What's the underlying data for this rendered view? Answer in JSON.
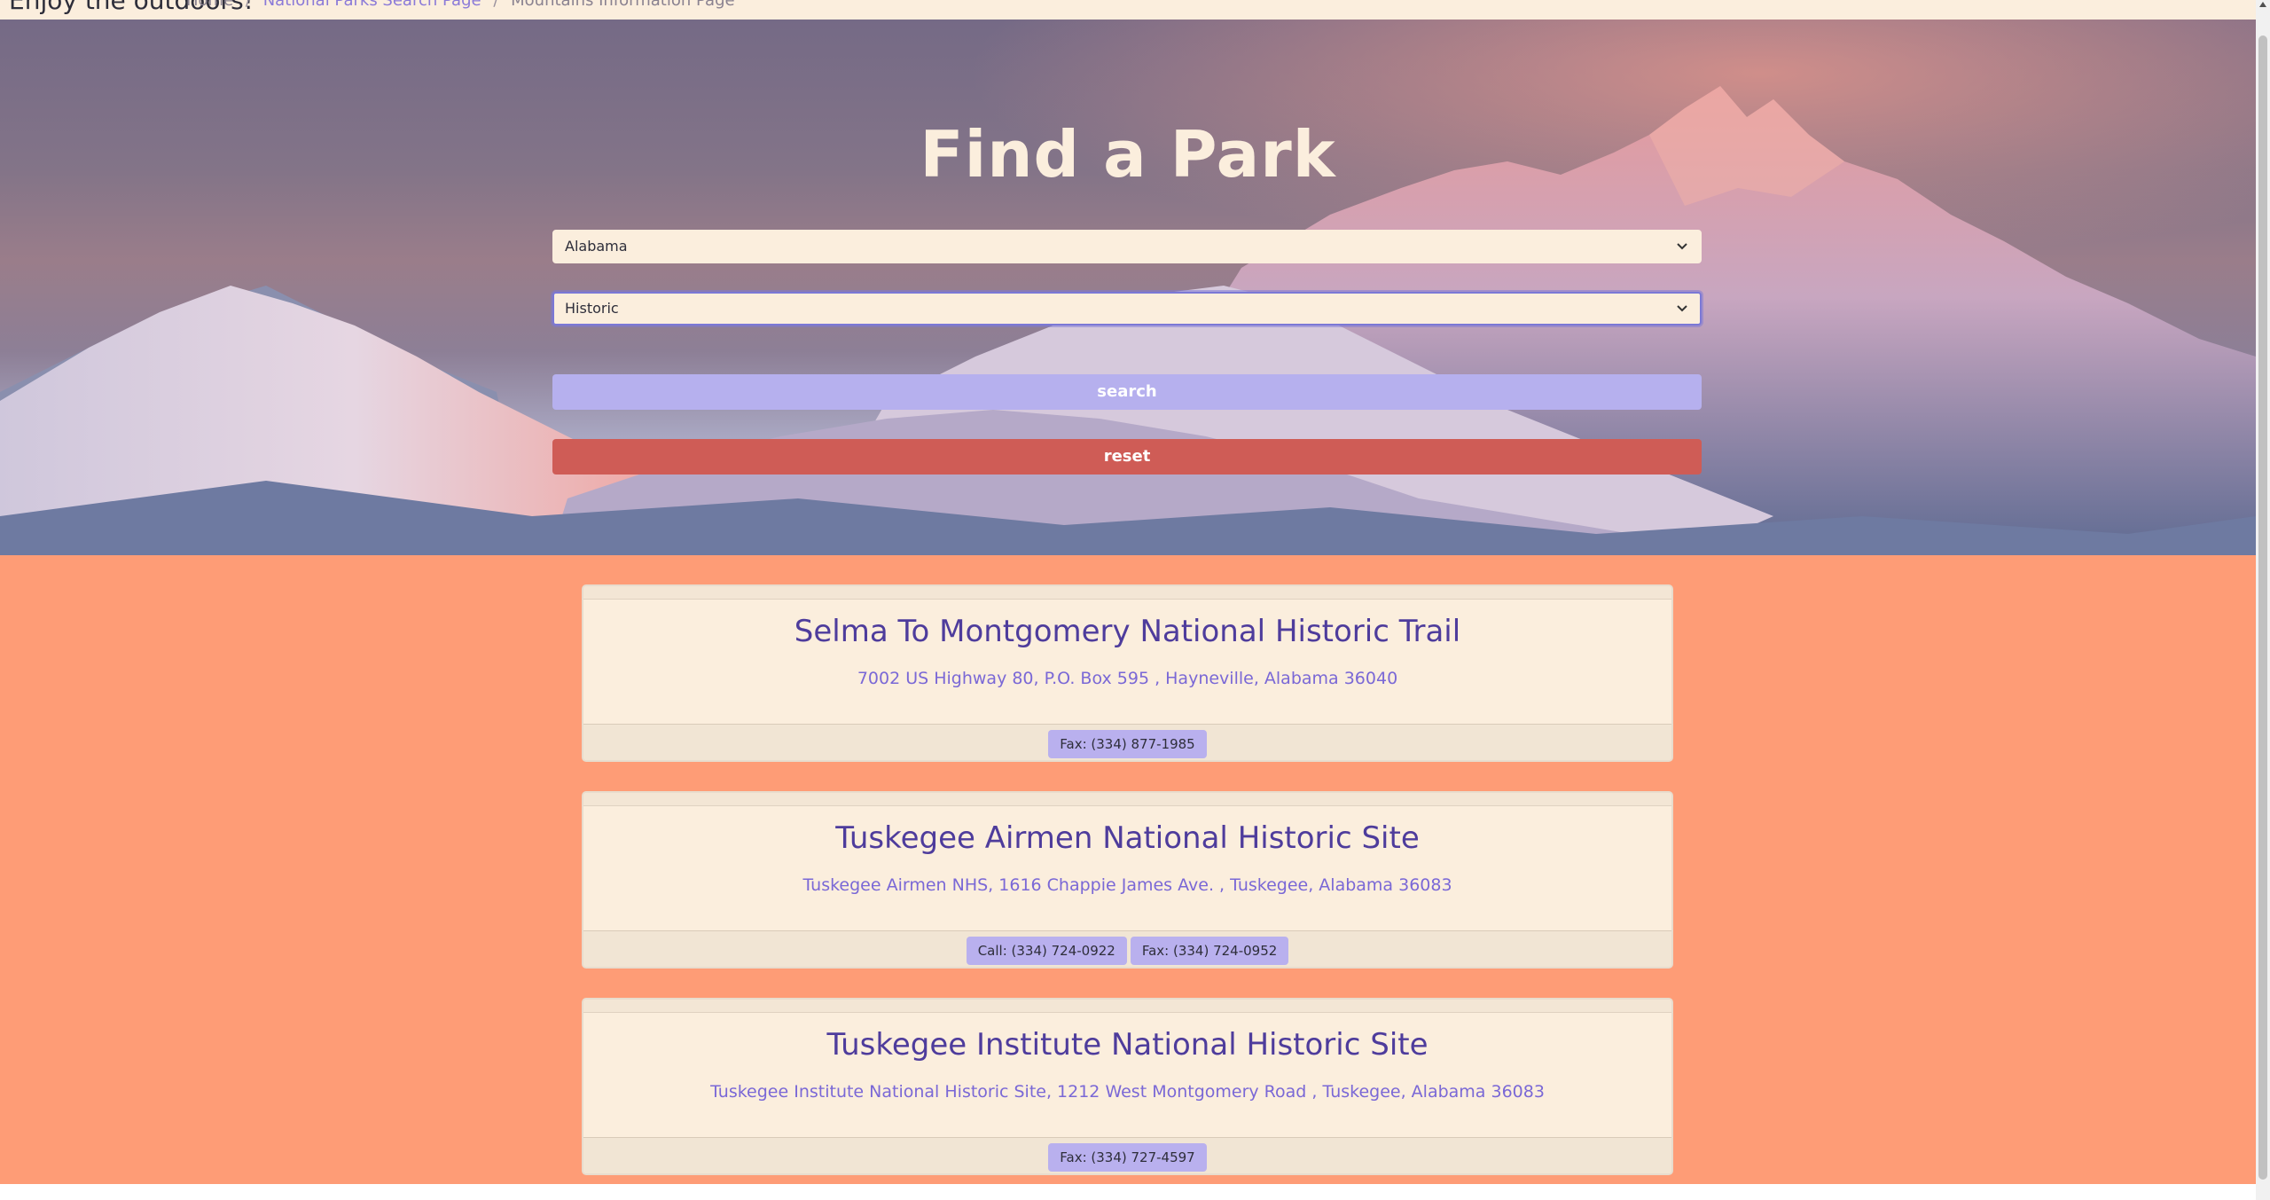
{
  "nav": {
    "brand": "Enjoy the outdoors!",
    "breadcrumbs": [
      {
        "label": "Home",
        "link": false
      },
      {
        "label": "National Parks Search Page",
        "link": true
      },
      {
        "label": "Mountains Information Page",
        "link": false
      }
    ]
  },
  "hero": {
    "title": "Find a Park",
    "state_select": {
      "value": "Alabama"
    },
    "type_select": {
      "value": "Historic"
    },
    "search_label": "search",
    "reset_label": "reset"
  },
  "results": [
    {
      "name": "Selma To Montgomery National Historic Trail",
      "address": "7002 US Highway 80, P.O. Box 595 , Hayneville, Alabama 36040",
      "contacts": [
        "Fax: (334) 877-1985"
      ]
    },
    {
      "name": "Tuskegee Airmen National Historic Site",
      "address": "Tuskegee Airmen NHS, 1616 Chappie James Ave. , Tuskegee, Alabama 36083",
      "contacts": [
        "Call: (334) 724-0922",
        "Fax: (334) 724-0952"
      ]
    },
    {
      "name": "Tuskegee Institute National Historic Site",
      "address": "Tuskegee Institute National Historic Site, 1212 West Montgomery Road , Tuskegee, Alabama 36083",
      "contacts": [
        "Fax: (334) 727-4597"
      ]
    }
  ],
  "colors": {
    "page_background": "#fe9c76",
    "nav_background": "#fbeedd",
    "title_text": "#fbeedd",
    "search_button": "#b6b0ee",
    "reset_button": "#cf5c56",
    "card_title": "#4e3c9c",
    "card_address": "#7a68d6",
    "contact_badge": "#b9b0ee"
  }
}
